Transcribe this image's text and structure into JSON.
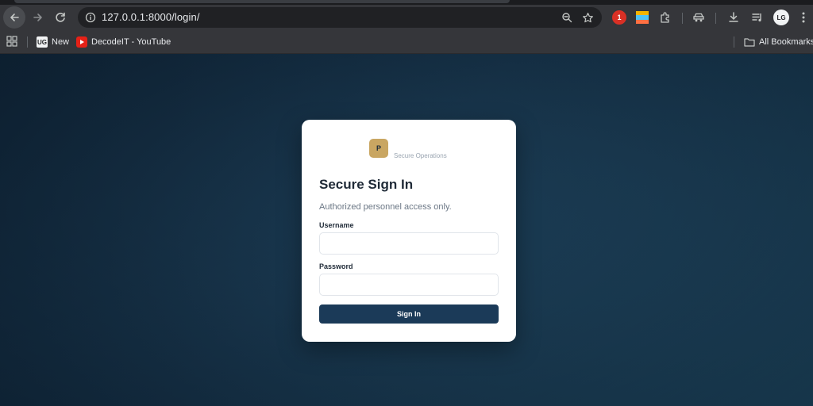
{
  "browser": {
    "url": "127.0.0.1:8000/login/",
    "avatar_text": "LG",
    "bookmarks": [
      {
        "label": "New",
        "icon": "ug-icon"
      },
      {
        "label": "DecodeIT - YouTube",
        "icon": "youtube-icon"
      }
    ],
    "all_bookmarks_label": "All Bookmarks",
    "ext_badge_text": "1"
  },
  "login": {
    "brand_letter": "P",
    "brand_text": "Secure Operations",
    "title": "Secure Sign In",
    "subtitle": "Authorized personnel access only.",
    "username_label": "Username",
    "username_value": "",
    "password_label": "Password",
    "password_value": "",
    "submit_label": "Sign In"
  },
  "colors": {
    "accent": "#1b3a58",
    "brand_badge": "#c9a662",
    "page_bg": "#173349"
  }
}
